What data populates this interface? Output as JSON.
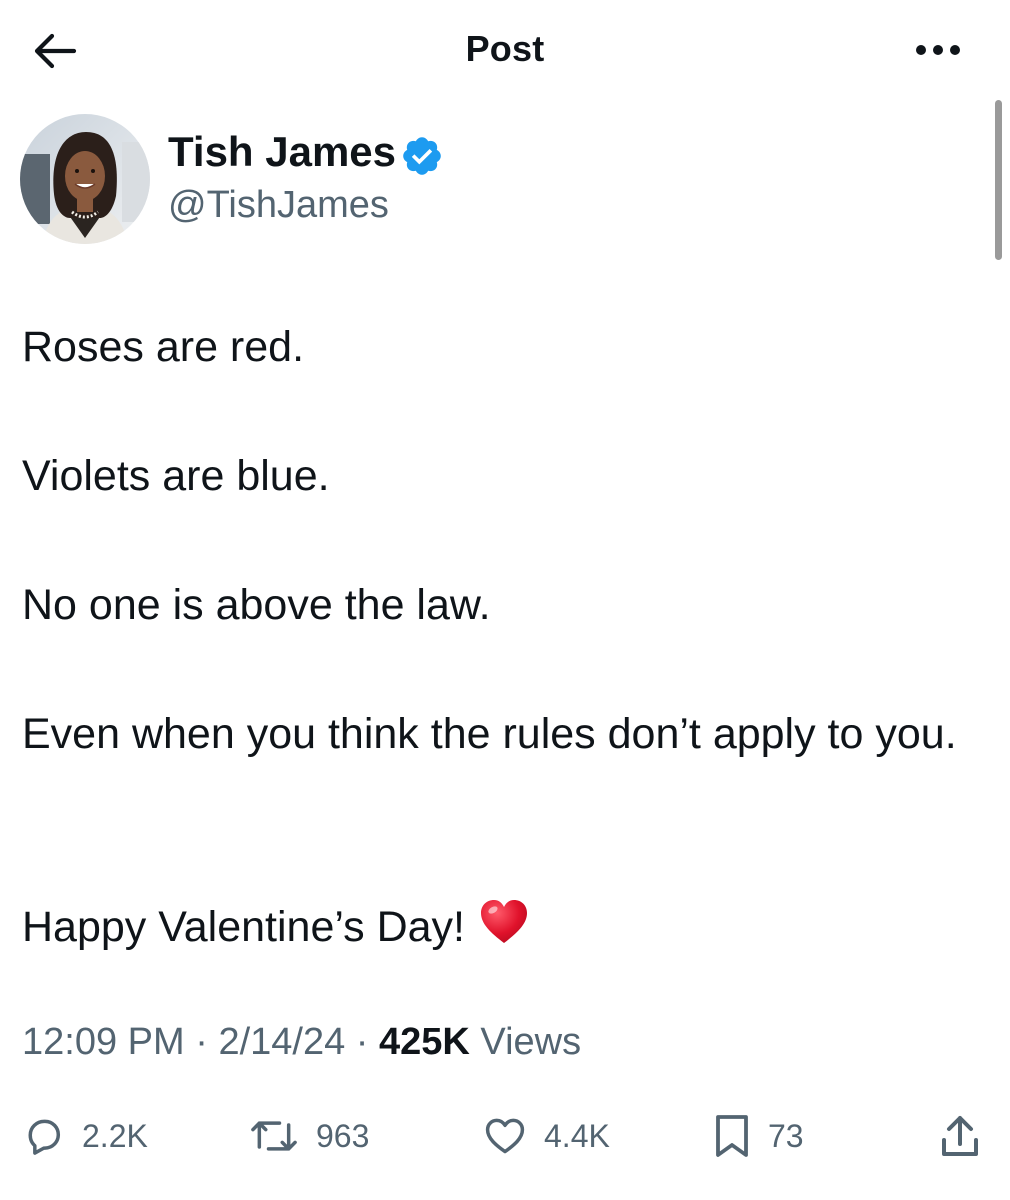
{
  "header": {
    "title": "Post",
    "back_icon": "arrow-left-icon",
    "more_icon": "ellipsis-icon"
  },
  "author": {
    "display_name": "Tish James",
    "handle": "@TishJames",
    "verified": true,
    "verified_color": "#1d9bf0"
  },
  "post": {
    "lines": [
      "Roses are red.",
      "Violets are blue.",
      "No one is above the law.",
      "Even when you think the rules don’t apply to you.",
      "Happy Valentine’s Day!"
    ],
    "emoji": "heart-emoji"
  },
  "meta": {
    "time": "12:09 PM",
    "date": "2/14/24",
    "views_count": "425K",
    "views_label": "Views",
    "separator": "·"
  },
  "actions": {
    "replies": "2.2K",
    "reposts": "963",
    "likes": "4.4K",
    "bookmarks": "73"
  },
  "colors": {
    "text": "#0f1419",
    "secondary": "#536471",
    "accent": "#1d9bf0",
    "heart": "#e0122b"
  }
}
